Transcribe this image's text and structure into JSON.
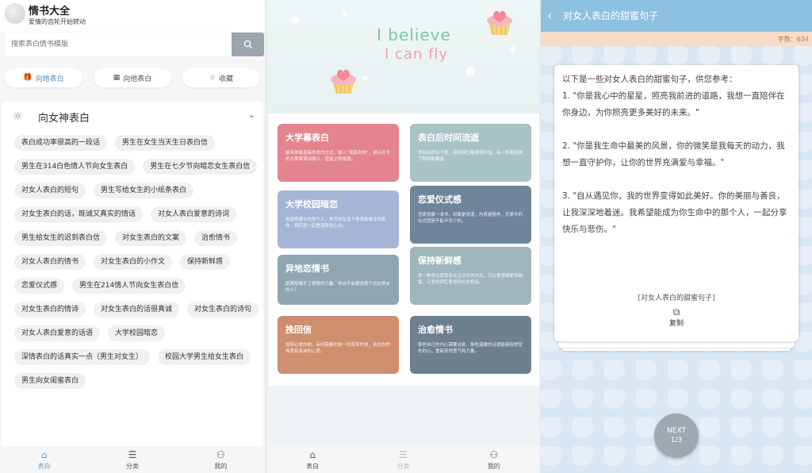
{
  "panel1": {
    "app_title": "情书大全",
    "app_subtitle": "爱情的齿轮开始转动",
    "search_placeholder": "搜索表白情书模版",
    "search_icon": "search-icon",
    "tabs": [
      {
        "label": "向她表白",
        "icon": "gift-icon",
        "active": true
      },
      {
        "label": "向他表白",
        "icon": "calendar-icon",
        "active": false
      },
      {
        "label": "收藏",
        "icon": "star-icon",
        "active": false
      }
    ],
    "section_title": "向女神表白",
    "chips": [
      "表白成功率很高的一段话",
      "男生在女生当天生日表白信",
      "男生在314白色情人节向女生表白",
      "男生在七夕节向暗恋女生表白信",
      "对女人表白的短句",
      "男生写给女生的小纸条表白",
      "对女生表白的话，既诚又真实的情话",
      "对女人表白爱意的诗词",
      "男生给女生的迟到表白信",
      "对女生表白的文案",
      "治愈情书",
      "对女人表白的情书",
      "对女生表白的小作文",
      "保持新鲜感",
      "恋爱仪式感",
      "男生在214情人节向女生表白信",
      "对女生表白的情诗",
      "对女生表白的话很真诚",
      "对女生表白的诗句",
      "对女人表白爱意的话语",
      "大学校园暗恋",
      "深情表白的话真实一点（男生对女生）",
      "校园大学男生给女生表白",
      "男生向女闺蜜表白"
    ],
    "nav": [
      {
        "label": "表白",
        "icon": "home-icon",
        "active": true
      },
      {
        "label": "分类",
        "icon": "list-icon",
        "active": false
      },
      {
        "label": "我的",
        "icon": "user-icon",
        "active": false
      }
    ]
  },
  "panel2": {
    "banner_line1": "I believe",
    "banner_line2": "I can fly",
    "cards": [
      {
        "title": "大学幕表白",
        "desc": "最简单最直接的表白方式，输入“我喜欢你”，展示在手机大屏幕滚动展示，营造立即氛围。",
        "color": "#e3848f"
      },
      {
        "title": "表白后时间流逝",
        "desc": "表白后的日子里，每份回忆都值得珍惜，每一秒都充满了期待和甜蜜。",
        "color": "#a8c3c6"
      },
      {
        "title": "大学校园暗恋",
        "desc": "校园青春中的那个人，是否也在某个角落偷偷注视着你，我们来一起重温那份心动。",
        "color": "#a4b5d6"
      },
      {
        "title": "恋爱仪式感",
        "desc": "恋爱就像一本书，封面是浪漫，内容是陪伴，恋爱中的仪式感是不能不可少的。",
        "color": "#70849b"
      },
      {
        "title": "异地恋情书",
        "desc": "距离阻隔不了爱情的力量，你会不会想念那个远在他乡的人？",
        "color": "#8fa6b2"
      },
      {
        "title": "保持新鲜感",
        "desc": "爱一种表达爱意和关注对方的方式，可以使感情更加甜蜜，让爱的回忆更加持久的色彩。",
        "color": "#9fb6be"
      },
      {
        "title": "挽回信",
        "desc": "挽回心爱的他，有时需要的是一份真挚的信，表达你的悔意和真诚的心意。",
        "color": "#cf8e6d"
      },
      {
        "title": "治愈情书",
        "desc": "那些自己的内心需要治愈，那些温暖的话语能够抚慰受伤的心，重新获得勇气和力量。",
        "color": "#6e7f90"
      }
    ],
    "nav": [
      {
        "label": "表白",
        "icon": "home-icon",
        "active": false
      },
      {
        "label": "分类",
        "icon": "list-icon",
        "active": true
      },
      {
        "label": "我的",
        "icon": "user-icon",
        "active": false
      }
    ]
  },
  "panel3": {
    "title": "对女人表白的甜蜜句子",
    "word_count": "字数：634",
    "intro": "以下是一些对女人表白的甜蜜句子，供您参考：",
    "paragraphs": [
      "1. \"你是我心中的星星，照亮我前进的道路，我想一直陪伴在你身边，为你照亮更多美好的未来。\"",
      "2. \"你是我生命中最美的风景，你的微笑是我每天的动力，我想一直守护你，让你的世界充满爱与幸福。\"",
      "3. \"自从遇见你，我的世界变得如此美好。你的美丽与善良，让我深深地着迷。我希望能成为你生命中的那个人，一起分享快乐与悲伤。\""
    ],
    "source_label": "[对女人表白的甜蜜句子]",
    "copy_label": "复制",
    "next_label": "NEXT",
    "page_indicator": "1/3"
  }
}
